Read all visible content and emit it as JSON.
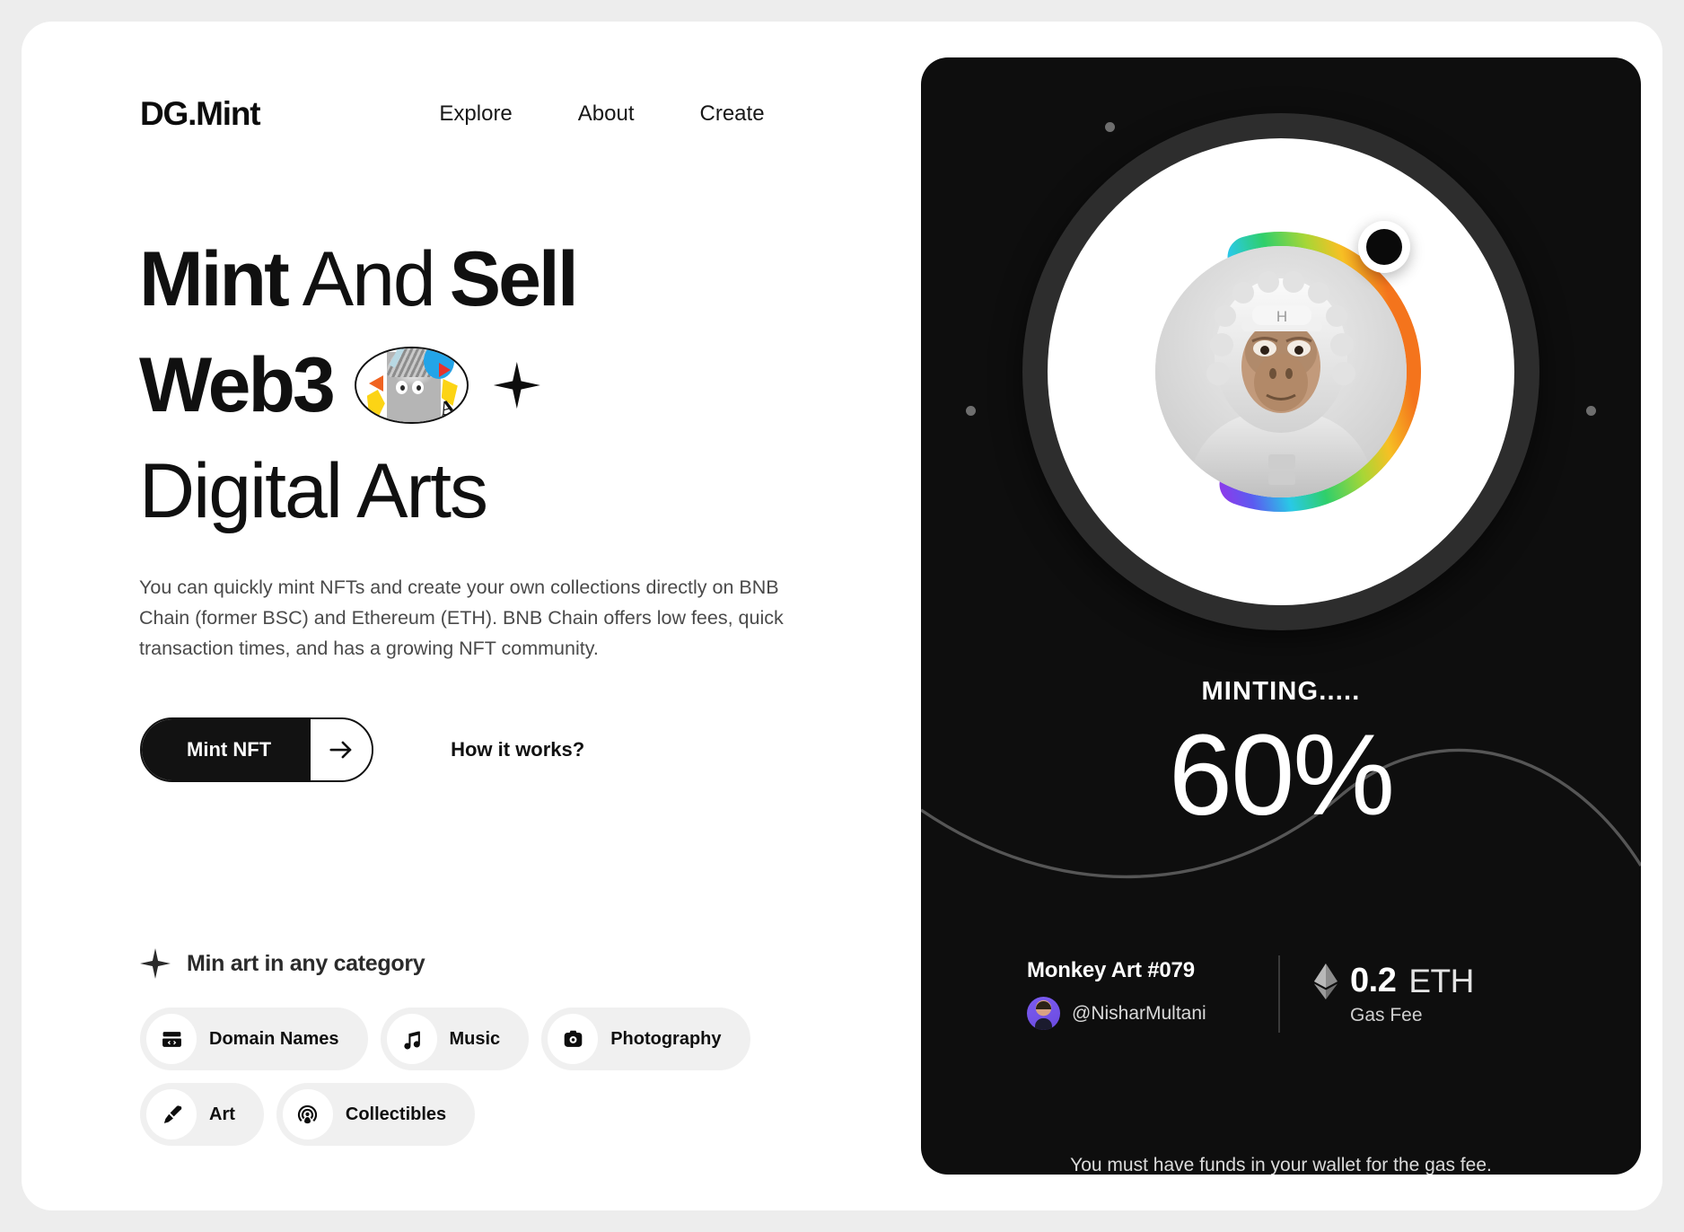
{
  "brand": {
    "logo": "DG.Mint"
  },
  "nav": {
    "items": [
      {
        "label": "Explore",
        "name": "nav-link-explore"
      },
      {
        "label": "About",
        "name": "nav-link-about"
      },
      {
        "label": "Create",
        "name": "nav-link-create"
      }
    ]
  },
  "hero": {
    "line1_bold_a": "Mint",
    "line1_light": "And",
    "line1_bold_b": "Sell",
    "line2_bold": "Web3",
    "line3_light": "Digital Arts",
    "collage_scribble": "A",
    "description": "You can quickly mint NFTs and create your own collections directly on BNB Chain (former BSC) and Ethereum (ETH). BNB Chain offers low fees, quick transaction times, and has a growing NFT community.",
    "primary_cta": "Mint NFT",
    "secondary_cta": "How it works?"
  },
  "categories": {
    "heading": "Min art in any category",
    "items": [
      {
        "label": "Domain Names",
        "icon": "domain-icon"
      },
      {
        "label": "Music",
        "icon": "music-note-icon"
      },
      {
        "label": "Photography",
        "icon": "camera-icon"
      },
      {
        "label": "Art",
        "icon": "paintbrush-icon"
      },
      {
        "label": "Collectibles",
        "icon": "collectibles-icon"
      }
    ]
  },
  "mint_card": {
    "status_label": "MINTING.....",
    "progress_text": "60%",
    "progress_value": 60,
    "nft_title": "Monkey Art #079",
    "owner_handle": "@NisharMultani",
    "gas_price_value": "0.2",
    "gas_price_currency": "ETH",
    "gas_fee_label": "Gas Fee",
    "wallet_note": "You must have funds in your wallet for the gas fee.",
    "colors": {
      "card_bg": "#0e0e0e",
      "ring_track": "#2d2d2d",
      "ring_inner": "#ffffff",
      "gradient_start": "#f97316",
      "gradient_mid_a": "#facc15",
      "gradient_mid_b": "#22c55e",
      "gradient_mid_c": "#22d3ee",
      "gradient_mid_d": "#3b82f6",
      "gradient_end": "#c026d3",
      "knob": "#0a0a0a"
    }
  },
  "page_colors": {
    "page_bg": "#ededed",
    "card_bg": "#ffffff",
    "text_primary": "#101010",
    "text_muted": "#4a4a4a",
    "chip_bg": "#f0f0f0"
  }
}
